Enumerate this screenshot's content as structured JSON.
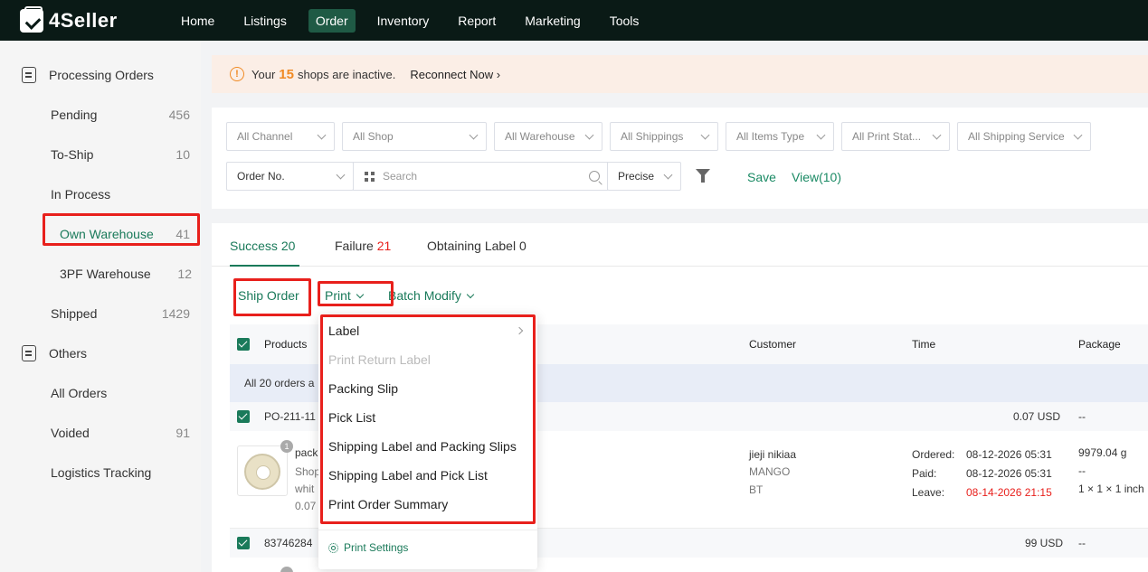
{
  "app": {
    "name": "4Seller"
  },
  "topnav": {
    "items": [
      "Home",
      "Listings",
      "Order",
      "Inventory",
      "Report",
      "Marketing",
      "Tools"
    ],
    "active": "Order"
  },
  "sidebar": {
    "processing_title": "Processing Orders",
    "items": [
      {
        "label": "Pending",
        "count": "456"
      },
      {
        "label": "To-Ship",
        "count": "10"
      },
      {
        "label": "In Process",
        "count": ""
      },
      {
        "label": "Own Warehouse",
        "count": "41"
      },
      {
        "label": "3PF Warehouse",
        "count": "12"
      },
      {
        "label": "Shipped",
        "count": "1429"
      }
    ],
    "others_title": "Others",
    "others": [
      {
        "label": "All Orders",
        "count": ""
      },
      {
        "label": "Voided",
        "count": "91"
      },
      {
        "label": "Logistics Tracking",
        "count": ""
      }
    ]
  },
  "banner": {
    "prefix": "Your",
    "count": "15",
    "suffix": "shops are inactive.",
    "action": "Reconnect Now"
  },
  "filters": {
    "channel": "All Channel",
    "shop": "All Shop",
    "warehouse": "All Warehouse",
    "shippings": "All Shippings",
    "items_type": "All Items Type",
    "print_status": "All Print Stat...",
    "shipping_service": "All Shipping Service",
    "search_field": "Order No.",
    "search_placeholder": "Search",
    "match": "Precise",
    "save": "Save",
    "view": "View(10)"
  },
  "tabs": {
    "success": "Success",
    "success_count": "20",
    "failure": "Failure",
    "failure_count": "21",
    "obtaining": "Obtaining Label",
    "obtaining_count": "0"
  },
  "actions": {
    "ship_order": "Ship Order",
    "print": "Print",
    "batch_modify": "Batch Modify"
  },
  "table": {
    "headers": {
      "products": "Products",
      "customer": "Customer",
      "time": "Time",
      "package": "Package"
    },
    "all_orders_text": "All 20 orders a",
    "rows": [
      {
        "order_id": "PO-211-11",
        "price": "0.07 USD",
        "package_hdr": "--",
        "product_lines": [
          "pack",
          "Shop",
          "whit",
          "0.07"
        ],
        "qty_badge": "1",
        "customer": [
          "jieji nikiaa",
          "MANGO",
          "BT"
        ],
        "ordered_label": "Ordered:",
        "ordered": "08-12-2026 05:31",
        "paid_label": "Paid:",
        "paid": "08-12-2026 05:31",
        "leave_label": "Leave:",
        "leave": "08-14-2026 21:15",
        "package": [
          "9979.04 g",
          "--",
          "1 × 1 × 1 inch"
        ]
      },
      {
        "order_id": "83746284",
        "price": "99 USD",
        "package_hdr": "--"
      }
    ]
  },
  "print_menu": {
    "items": [
      "Label",
      "Print Return Label",
      "Packing Slip",
      "Pick List",
      "Shipping Label and Packing Slips",
      "Shipping Label and Pick List",
      "Print Order Summary"
    ],
    "settings": "Print Settings"
  },
  "colors": {
    "accent": "#1a7a5a",
    "highlight": "#e8201c",
    "warning": "#f08a24",
    "nav_bg": "#0a1a16"
  }
}
